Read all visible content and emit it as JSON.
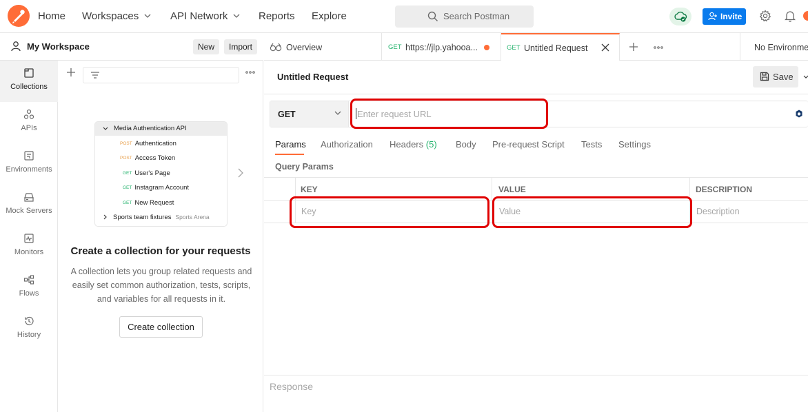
{
  "topnav": {
    "items": [
      {
        "label": "Home"
      },
      {
        "label": "Workspaces"
      },
      {
        "label": "API Network"
      },
      {
        "label": "Reports"
      },
      {
        "label": "Explore"
      }
    ],
    "search_placeholder": "Search Postman",
    "invite_label": "Invite",
    "icons": [
      "postman-logo",
      "search-icon",
      "cloud-sync-icon",
      "add-user-icon",
      "settings-icon",
      "bell-icon"
    ]
  },
  "workspace": {
    "title": "My Workspace",
    "new_label": "New",
    "import_label": "Import"
  },
  "sidebar": {
    "items": [
      {
        "label": "Collections",
        "icon": "collections-icon",
        "active": true
      },
      {
        "label": "APIs",
        "icon": "apis-icon"
      },
      {
        "label": "Environments",
        "icon": "environments-icon"
      },
      {
        "label": "Mock Servers",
        "icon": "mock-servers-icon"
      },
      {
        "label": "Monitors",
        "icon": "monitors-icon"
      },
      {
        "label": "Flows",
        "icon": "flows-icon"
      },
      {
        "label": "History",
        "icon": "history-icon"
      }
    ]
  },
  "collections_panel": {
    "illustration": {
      "folder": "Media Authentication API",
      "requests": [
        {
          "method": "POST",
          "name": "Authentication"
        },
        {
          "method": "POST",
          "name": "Access Token"
        },
        {
          "method": "GET",
          "name": "User's Page"
        },
        {
          "method": "GET",
          "name": "Instagram Account"
        },
        {
          "method": "GET",
          "name": "New Request"
        }
      ],
      "second_folder": "Sports team fixtures",
      "second_folder_sub": "Sports Arena"
    },
    "empty_title": "Create a collection for your requests",
    "empty_desc": "A collection lets you group related requests and easily set common authorization, tests, scripts, and variables for all requests in it.",
    "create_button": "Create collection"
  },
  "tabs": [
    {
      "label": "Overview",
      "icon": "overview-icon"
    },
    {
      "method": "GET",
      "label": "https://jlp.yahooa...",
      "unsaved": true
    },
    {
      "method": "GET",
      "label": "Untitled Request",
      "active": true
    }
  ],
  "environment": "No Environment",
  "request": {
    "title": "Untitled Request",
    "save_label": "Save",
    "method": "GET",
    "url_placeholder": "Enter request URL",
    "tabs": [
      {
        "label": "Params",
        "active": true
      },
      {
        "label": "Authorization"
      },
      {
        "label": "Headers",
        "count": "(5)"
      },
      {
        "label": "Body"
      },
      {
        "label": "Pre-request Script"
      },
      {
        "label": "Tests"
      },
      {
        "label": "Settings"
      }
    ],
    "query_params_label": "Query Params",
    "table": {
      "headers": [
        "KEY",
        "VALUE",
        "DESCRIPTION"
      ],
      "placeholders": [
        "Key",
        "Value",
        "Description"
      ]
    }
  },
  "response": {
    "label": "Response"
  },
  "colors": {
    "accent": "#ff6c37",
    "primary": "#097bed",
    "highlight": "#e00000",
    "get": "#26b36e",
    "post": "#e8a04d"
  }
}
